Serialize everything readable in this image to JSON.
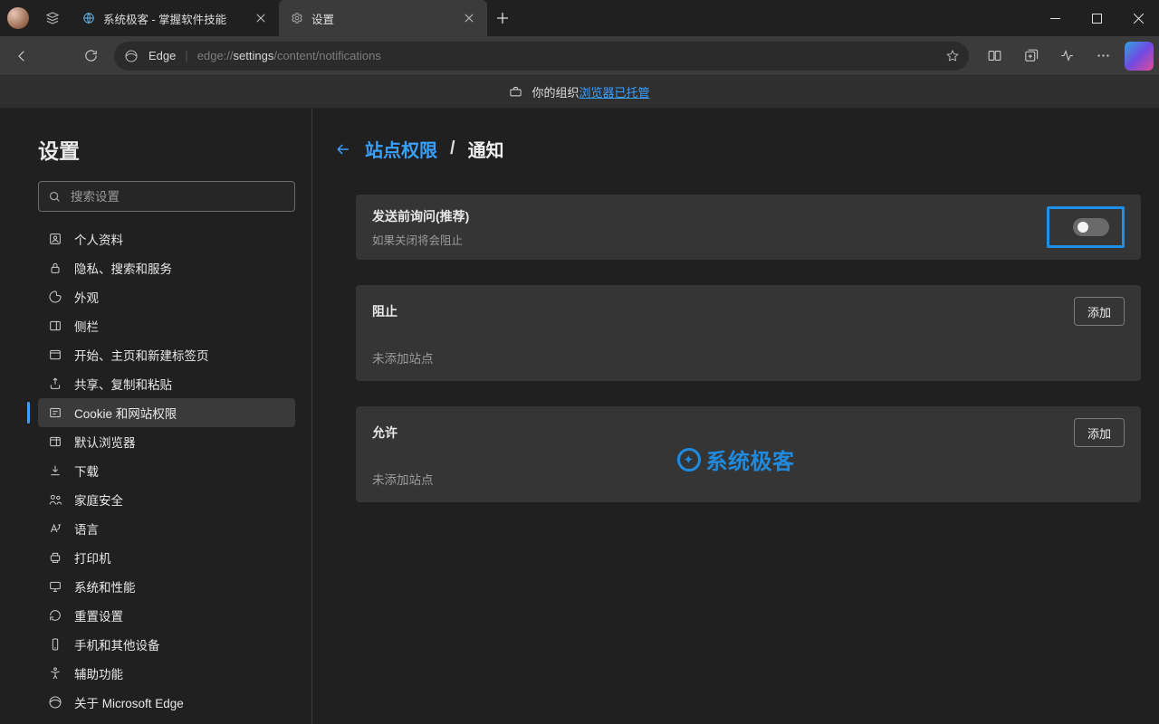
{
  "tabs": [
    {
      "title": "系统极客 - 掌握软件技能"
    },
    {
      "title": "设置"
    }
  ],
  "omnibox": {
    "engine": "Edge",
    "url_prefix": "edge://",
    "url_high": "settings",
    "url_suffix": "/content/notifications"
  },
  "banner": {
    "prefix": "你的组织",
    "link": "浏览器已托管"
  },
  "sidebar": {
    "title": "设置",
    "search_placeholder": "搜索设置",
    "items": [
      {
        "label": "个人资料"
      },
      {
        "label": "隐私、搜索和服务"
      },
      {
        "label": "外观"
      },
      {
        "label": "侧栏"
      },
      {
        "label": "开始、主页和新建标签页"
      },
      {
        "label": "共享、复制和粘贴"
      },
      {
        "label": "Cookie 和网站权限"
      },
      {
        "label": "默认浏览器"
      },
      {
        "label": "下载"
      },
      {
        "label": "家庭安全"
      },
      {
        "label": "语言"
      },
      {
        "label": "打印机"
      },
      {
        "label": "系统和性能"
      },
      {
        "label": "重置设置"
      },
      {
        "label": "手机和其他设备"
      },
      {
        "label": "辅助功能"
      },
      {
        "label": "关于 Microsoft Edge"
      }
    ]
  },
  "breadcrumb": {
    "parent": "站点权限",
    "sep": "/",
    "current": "通知"
  },
  "cards": {
    "ask": {
      "title": "发送前询问(推荐)",
      "sub": "如果关闭将会阻止"
    },
    "block": {
      "title": "阻止",
      "addLabel": "添加",
      "empty": "未添加站点"
    },
    "allow": {
      "title": "允许",
      "addLabel": "添加",
      "empty": "未添加站点"
    }
  },
  "watermark": "系统极客"
}
